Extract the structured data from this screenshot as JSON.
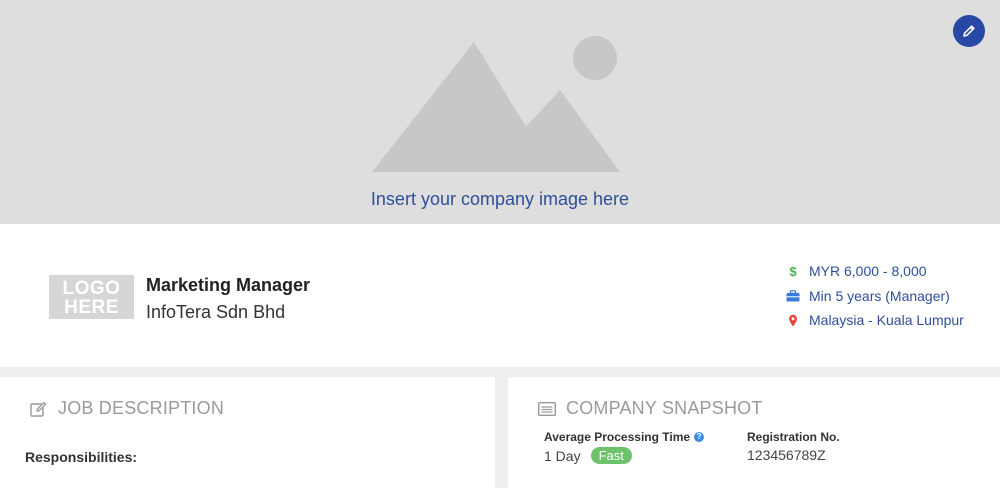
{
  "banner": {
    "placeholder_text": "Insert your company image here",
    "edit_icon": "pencil-icon",
    "art_icon": "image-placeholder-icon"
  },
  "job": {
    "logo_line1": "LOGO",
    "logo_line2": "HERE",
    "title": "Marketing Manager",
    "company": "InfoTera Sdn Bhd"
  },
  "meta": {
    "salary": "MYR 6,000 - 8,000",
    "experience": "Min 5 years (Manager)",
    "location": "Malaysia - Kuala Lumpur",
    "salary_icon": "dollar-icon",
    "experience_icon": "briefcase-icon",
    "location_icon": "map-pin-icon"
  },
  "job_description": {
    "heading": "JOB DESCRIPTION",
    "responsibilities_label": "Responsibilities:"
  },
  "company_snapshot": {
    "heading": "COMPANY SNAPSHOT",
    "processing_label": "Average Processing Time",
    "processing_value": "1 Day",
    "processing_badge": "Fast",
    "registration_label": "Registration No.",
    "registration_value": "123456789Z"
  },
  "colors": {
    "accent": "#2748a5",
    "link": "#2f4f9a",
    "badge_green": "#6cc36b",
    "salary_green": "#4cb050",
    "pin_red": "#e8483b",
    "briefcase_blue": "#3a7bd5"
  }
}
